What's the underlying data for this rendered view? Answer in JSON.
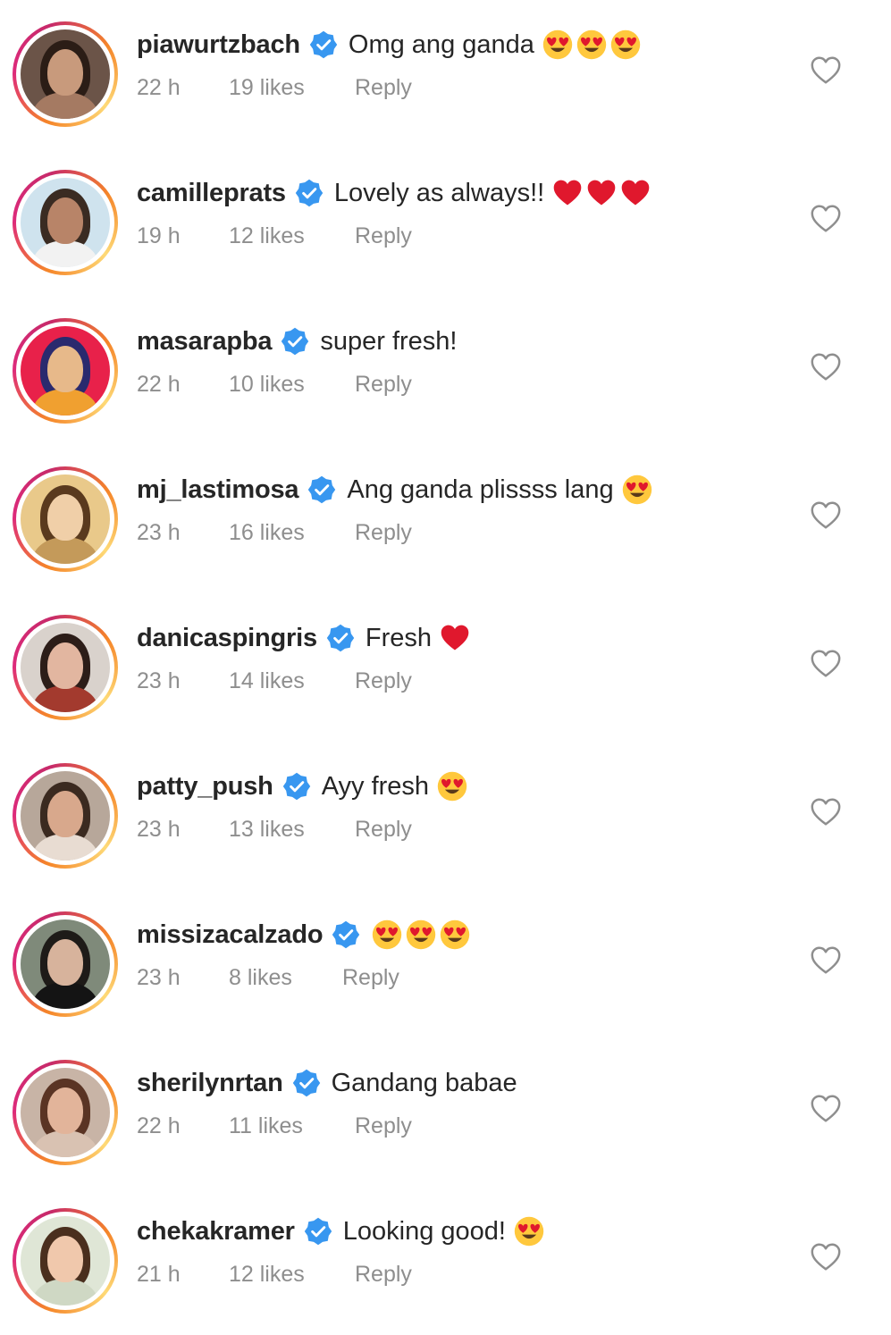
{
  "comments": [
    {
      "username": "piawurtzbach",
      "text": "Omg ang ganda",
      "emojis": [
        "heart-eyes-emoji",
        "heart-eyes-emoji",
        "heart-eyes-emoji"
      ],
      "time": "22 h",
      "likes": "19 likes",
      "reply_label": "Reply",
      "avatar_colors": {
        "bg": "#6b5448",
        "hair": "#2b1d16",
        "face": "#c89a7c",
        "body": "#a57a62"
      }
    },
    {
      "username": "camilleprats",
      "text": "Lovely as always!!",
      "emojis": [
        "red-heart-emoji",
        "red-heart-emoji",
        "red-heart-emoji"
      ],
      "time": "19 h",
      "likes": "12 likes",
      "reply_label": "Reply",
      "avatar_colors": {
        "bg": "#cfe3ee",
        "hair": "#3a2b22",
        "face": "#b88468",
        "body": "#f2f2f2"
      }
    },
    {
      "username": "masarapba",
      "text": "super fresh!",
      "emojis": [],
      "time": "22 h",
      "likes": "10 likes",
      "reply_label": "Reply",
      "avatar_colors": {
        "bg": "#e8214a",
        "hair": "#2a2a6e",
        "face": "#e7b98a",
        "body": "#f0a030"
      }
    },
    {
      "username": "mj_lastimosa",
      "text": "Ang ganda plissss lang",
      "emojis": [
        "heart-eyes-emoji"
      ],
      "time": "23 h",
      "likes": "16 likes",
      "reply_label": "Reply",
      "avatar_colors": {
        "bg": "#e9c98a",
        "hair": "#5a3a1e",
        "face": "#f0cfa8",
        "body": "#c49a5a"
      }
    },
    {
      "username": "danicaspingris",
      "text": "Fresh",
      "emojis": [
        "red-heart-emoji"
      ],
      "time": "23 h",
      "likes": "14 likes",
      "reply_label": "Reply",
      "avatar_colors": {
        "bg": "#d9d2cc",
        "hair": "#2c1d18",
        "face": "#e2b6a0",
        "body": "#a33a2e"
      }
    },
    {
      "username": "patty_push",
      "text": "Ayy fresh",
      "emojis": [
        "heart-eyes-emoji"
      ],
      "time": "23 h",
      "likes": "13 likes",
      "reply_label": "Reply",
      "avatar_colors": {
        "bg": "#b7a79a",
        "hair": "#3b2a20",
        "face": "#d8a88c",
        "body": "#e8dcd2"
      }
    },
    {
      "username": "missizacalzado",
      "text": "",
      "emojis": [
        "heart-eyes-emoji",
        "heart-eyes-emoji",
        "heart-eyes-emoji"
      ],
      "time": "23 h",
      "likes": "8 likes",
      "reply_label": "Reply",
      "avatar_colors": {
        "bg": "#7f8a7a",
        "hair": "#1e1b18",
        "face": "#d7b39c",
        "body": "#141414"
      }
    },
    {
      "username": "sherilynrtan",
      "text": "Gandang babae",
      "emojis": [],
      "time": "22 h",
      "likes": "11 likes",
      "reply_label": "Reply",
      "avatar_colors": {
        "bg": "#c8b4a6",
        "hair": "#5a3424",
        "face": "#e2b49a",
        "body": "#d9c2b2"
      }
    },
    {
      "username": "chekakramer",
      "text": "Looking good!",
      "emojis": [
        "heart-eyes-emoji"
      ],
      "time": "21 h",
      "likes": "12 likes",
      "reply_label": "Reply",
      "avatar_colors": {
        "bg": "#dfe6d6",
        "hair": "#4a2f1e",
        "face": "#f0c8ac",
        "body": "#cfd8c4"
      }
    }
  ],
  "colors": {
    "text_primary": "#262626",
    "text_secondary": "#8e8e8e",
    "verified_blue": "#3897f0",
    "heart_red": "#e0182d",
    "emoji_yellow": "#ffc83d"
  }
}
